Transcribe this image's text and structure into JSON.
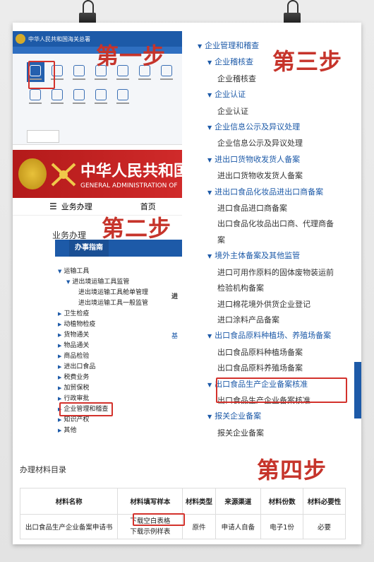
{
  "steps": {
    "one": "第一步",
    "two": "第二步",
    "three": "第三步",
    "four": "第四步"
  },
  "panel1": {
    "header_title": "中华人民共和国海关总署"
  },
  "panel2": {
    "title_cn": "中华人民共和国",
    "title_en": "GENERAL ADMINISTRATION OF",
    "menu_business": "业务办理",
    "menu_home": "首页",
    "section": "业务办理",
    "guide_tab": "办事指南",
    "tree": [
      {
        "level": 1,
        "label": "运输工具"
      },
      {
        "level": 2,
        "label": "进出境运输工具监管"
      },
      {
        "level": 3,
        "label": "进出境运输工具舱单管理"
      },
      {
        "level": 3,
        "label": "进出境运输工具一般监管"
      },
      {
        "level": 1,
        "label": "卫生检疫"
      },
      {
        "level": 1,
        "label": "动植物检疫"
      },
      {
        "level": 1,
        "label": "货物通关"
      },
      {
        "level": 1,
        "label": "物品通关"
      },
      {
        "level": 1,
        "label": "商品检验"
      },
      {
        "level": 1,
        "label": "进出口食品"
      },
      {
        "level": 1,
        "label": "税费业务"
      },
      {
        "level": 1,
        "label": "加贸保税"
      },
      {
        "level": 1,
        "label": "行政审批"
      },
      {
        "level": 1,
        "label": "企业管理和稽查"
      },
      {
        "level": 1,
        "label": "知识产权"
      },
      {
        "level": 1,
        "label": "其他"
      }
    ],
    "right_text_1": "进",
    "right_text_2": "基"
  },
  "panel3": {
    "items": [
      {
        "type": "h",
        "label": "企业管理和稽查"
      },
      {
        "type": "h",
        "label": "企业稽核查"
      },
      {
        "type": "c",
        "label": "企业稽核查"
      },
      {
        "type": "h",
        "label": "企业认证"
      },
      {
        "type": "c",
        "label": "企业认证"
      },
      {
        "type": "h",
        "label": "企业信息公示及异议处理"
      },
      {
        "type": "c",
        "label": "企业信息公示及异议处理"
      },
      {
        "type": "h",
        "label": "进出口货物收发货人备案"
      },
      {
        "type": "c",
        "label": "进出口货物收发货人备案"
      },
      {
        "type": "h",
        "label": "进出口食品化妆品进出口商备案"
      },
      {
        "type": "c",
        "label": "进口食品进口商备案"
      },
      {
        "type": "c",
        "label": "出口食品化妆品出口商、代理商备"
      },
      {
        "type": "c",
        "label": "案"
      },
      {
        "type": "h",
        "label": "境外主体备案及其他监管"
      },
      {
        "type": "c",
        "label": "进口可用作原料的固体废物装运前"
      },
      {
        "type": "c",
        "label": "检验机构备案"
      },
      {
        "type": "c",
        "label": "进口棉花境外供货企业登记"
      },
      {
        "type": "c",
        "label": "进口涂料产品备案"
      },
      {
        "type": "h",
        "label": "出口食品原料种植场、养殖场备案"
      },
      {
        "type": "c",
        "label": "出口食品原料种植场备案"
      },
      {
        "type": "c",
        "label": "出口食品原料养殖场备案"
      },
      {
        "type": "h",
        "label": "出口食品生产企业备案核准"
      },
      {
        "type": "c",
        "label": "出口食品生产企业备案核准"
      },
      {
        "type": "h",
        "label": "报关企业备案"
      },
      {
        "type": "c",
        "label": "报关企业备案"
      }
    ]
  },
  "panel4": {
    "title": "办理材料目录",
    "headers": [
      "材料名称",
      "材料填写样本",
      "材料类型",
      "来源渠道",
      "材料份数",
      "材料必要性"
    ],
    "row": {
      "name": "出口食品生产企业备案申请书",
      "sample_blank": "下载空白表格",
      "sample_example": "下载示例样表",
      "type": "原件",
      "source": "申请人自备",
      "copies": "电子1份",
      "necessity": "必要"
    }
  }
}
